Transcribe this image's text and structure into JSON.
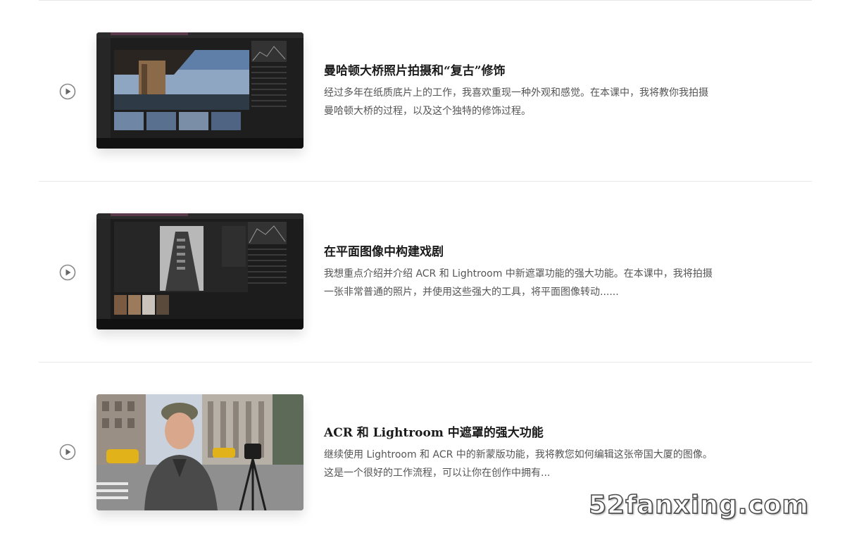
{
  "lessons": [
    {
      "title": "曼哈顿大桥照片拍摄和“复古”修饰",
      "description_line1": "经过多年在纸质底片上的工作，我喜欢重现一种外观和感觉。在本课中，我将教你我拍摄",
      "description_line2": "曼哈顿大桥的过程，以及这个独特的修饰过程。"
    },
    {
      "title": "在平面图像中构建戏剧",
      "description_line1": "我想重点介绍并介绍 ACR 和 Lightroom 中新遮罩功能的强大功能。在本课中，我将拍摄",
      "description_line2": "一张非常普通的照片，并使用这些强大的工具，将平面图像转动......"
    },
    {
      "title": "ACR 和 Lightroom 中遮罩的强大功能",
      "description_line1": "继续使用 Lightroom 和 ACR 中的新蒙版功能，我将教您如何编辑这张帝国大厦的图像。",
      "description_line2": "这是一个很好的工作流程，可以让你在创作中拥有..."
    }
  ],
  "icons": {
    "play": "play-circle-icon"
  },
  "watermark": "52fanxing.com",
  "colors": {
    "divider": "#e8e8e8",
    "title": "#1a1a1a",
    "text": "#555555",
    "icon": "#888888"
  }
}
